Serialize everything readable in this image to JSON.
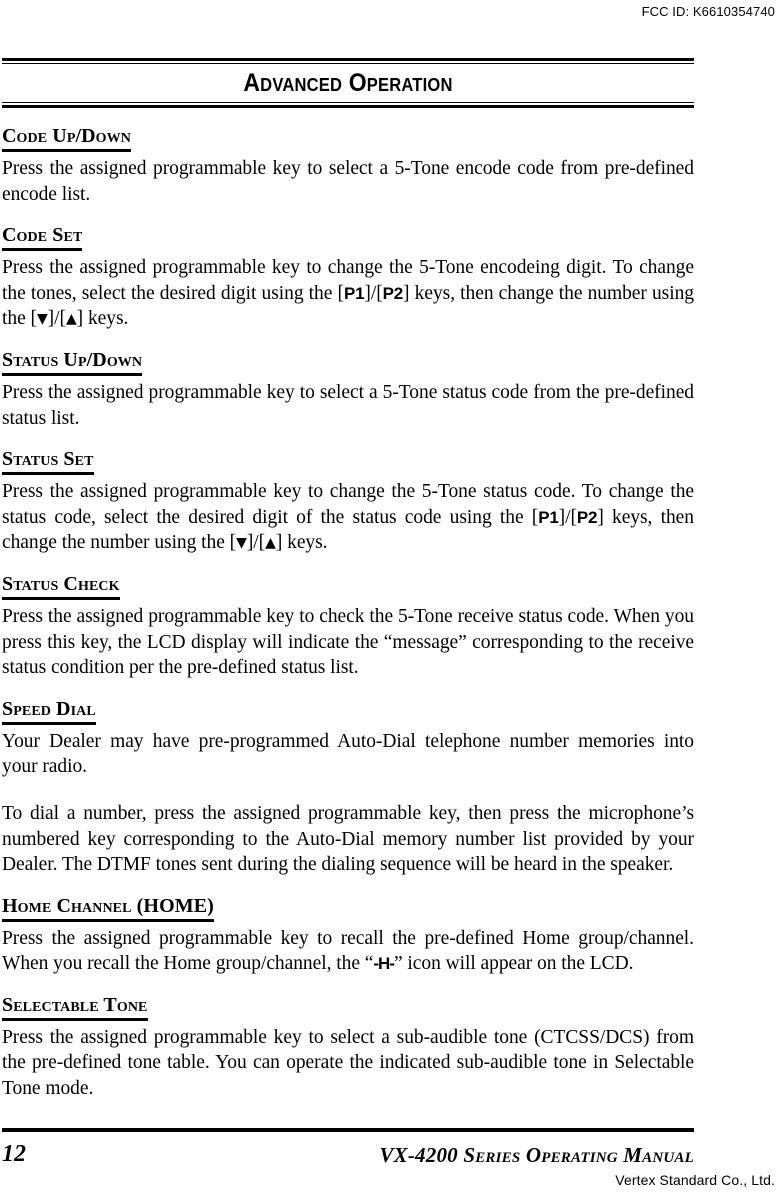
{
  "header": {
    "fcc_id": "FCC ID: K6610354740"
  },
  "chapter": {
    "title": "Advanced Operation"
  },
  "sections": [
    {
      "heading": "Code Up/Down",
      "paragraphs": [
        "Press the assigned programmable key to select a 5-Tone encode code from pre-defined encode list."
      ]
    },
    {
      "heading": "Code Set",
      "paragraphs": [
        "Press the assigned programmable key to change the 5-Tone encodeing digit. To change the tones, select the desired digit using the [P1]/[P2] keys, then change the number using the [▼]/[▲] keys."
      ]
    },
    {
      "heading": "Status Up/Down",
      "paragraphs": [
        "Press the assigned programmable key to select a 5-Tone status code from the pre-defined status list."
      ]
    },
    {
      "heading": "Status Set",
      "paragraphs": [
        "Press the assigned programmable key to change the 5-Tone status code. To change the status code, select the desired digit of the status code using the [P1]/[P2] keys, then change the number using the [▼]/[▲] keys."
      ]
    },
    {
      "heading": "Status Check",
      "paragraphs": [
        "Press the assigned programmable key to check the 5-Tone receive status code. When you press this key, the LCD display will indicate the “message” corresponding to the receive status condition per the pre-defined status list."
      ]
    },
    {
      "heading": "Speed Dial",
      "paragraphs": [
        "Your Dealer may have pre-programmed Auto-Dial telephone number memories into your radio.",
        "To dial a number, press the assigned programmable key, then press the microphone’s numbered key corresponding to the Auto-Dial memory number list provided by your Dealer. The DTMF tones sent during the dialing sequence will be heard in the speaker."
      ]
    },
    {
      "heading": "Home Channel (HOME)",
      "heading_main": "Home Channel",
      "heading_paren_open": "(",
      "heading_paren_text": "HOME",
      "heading_paren_close": ")",
      "paragraphs": [
        "Press the assigned programmable key to recall the pre-defined Home group/channel. When you recall the Home group/channel, the “-H-” icon will appear on the LCD."
      ]
    },
    {
      "heading": "Selectable Tone",
      "paragraphs": [
        "Press the assigned programmable key to select a sub-audible tone (CTCSS/DCS) from the pre-defined tone table. You can operate the indicated sub-audible tone in Selectable Tone mode."
      ]
    }
  ],
  "inline": {
    "key_p1": "P1",
    "key_p2": "P2",
    "key_down": "▼",
    "key_up": "▲",
    "lcd_home_icon": "-H-",
    "bracket_open": "[",
    "bracket_close": "]",
    "slash": "/"
  },
  "footer": {
    "page_number": "12",
    "manual_model": "VX-4200",
    "manual_title_rest": " Series Operating Manual",
    "company": "Vertex Standard Co., Ltd."
  },
  "colors": {
    "text": "#000000",
    "background": "#ffffff",
    "rule": "#000000"
  }
}
